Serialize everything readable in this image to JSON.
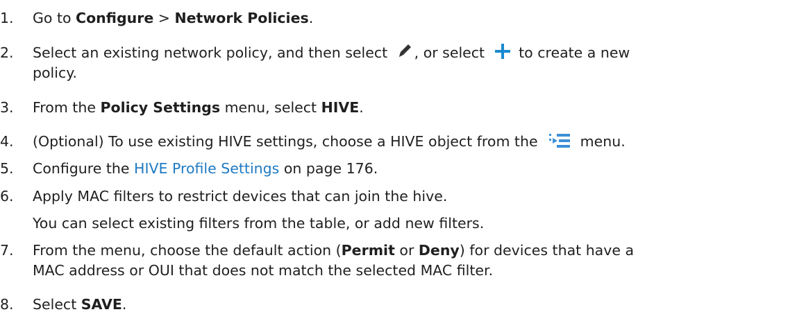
{
  "steps": [
    {
      "number": "1.",
      "parts": {
        "a": "Go to ",
        "b": "Configure",
        "c": " > ",
        "d": "Network Policies",
        "e": "."
      }
    },
    {
      "number": "2.",
      "parts": {
        "a": "Select an existing network policy, and then select ",
        "b": ", or select ",
        "c": " to create a new"
      },
      "continuation": "policy.",
      "icons": [
        "pencil-icon",
        "plus-icon"
      ]
    },
    {
      "number": "3.",
      "parts": {
        "a": "From the ",
        "b": "Policy Settings",
        "c": " menu, select ",
        "d": "HIVE",
        "e": "."
      }
    },
    {
      "number": "4.",
      "parts": {
        "a": "(Optional) To use existing HIVE settings, choose a HIVE object from the ",
        "b": " menu."
      },
      "icons": [
        "list-select-icon"
      ]
    },
    {
      "number": "5.",
      "parts": {
        "a": "Configure the ",
        "link": "HIVE Profile Settings",
        "b": " on page 176."
      }
    },
    {
      "number": "6.",
      "parts": {
        "a": "Apply MAC filters to restrict devices that can join the hive."
      },
      "note": "You can select existing filters from the table, or add new filters."
    },
    {
      "number": "7.",
      "parts": {
        "a": "From the menu, choose the default action (",
        "b": "Permit",
        "c": " or ",
        "d": "Deny",
        "e": ") for devices that have a"
      },
      "continuation": "MAC address or OUI that does not match the selected MAC filter."
    },
    {
      "number": "8.",
      "parts": {
        "a": "Select ",
        "b": "SAVE",
        "c": "."
      }
    }
  ],
  "colors": {
    "text": "#1f1f1f",
    "link": "#1f7ac2",
    "plus_icon": "#1a8ad0",
    "pencil_icon": "#333333"
  }
}
